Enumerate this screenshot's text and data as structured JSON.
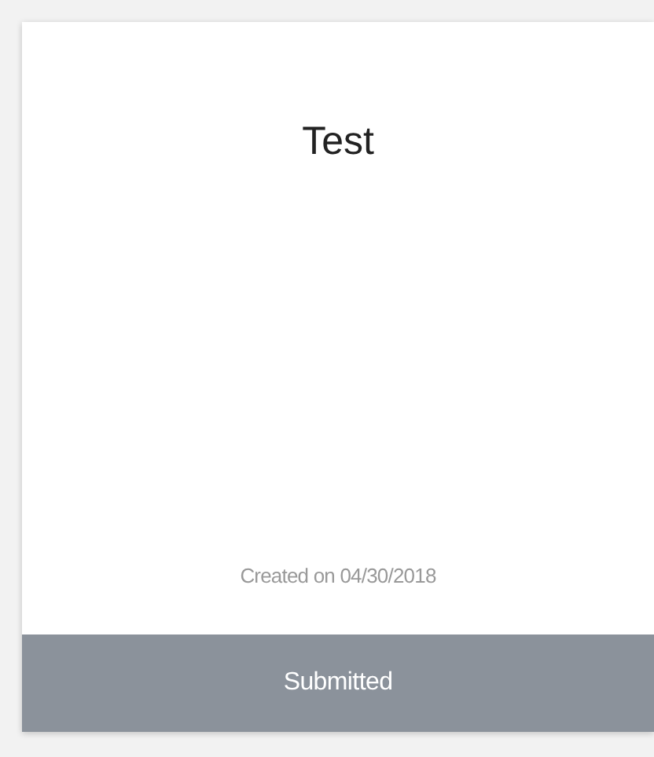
{
  "card": {
    "title": "Test",
    "created": "Created on 04/30/2018",
    "status": "Submitted"
  }
}
